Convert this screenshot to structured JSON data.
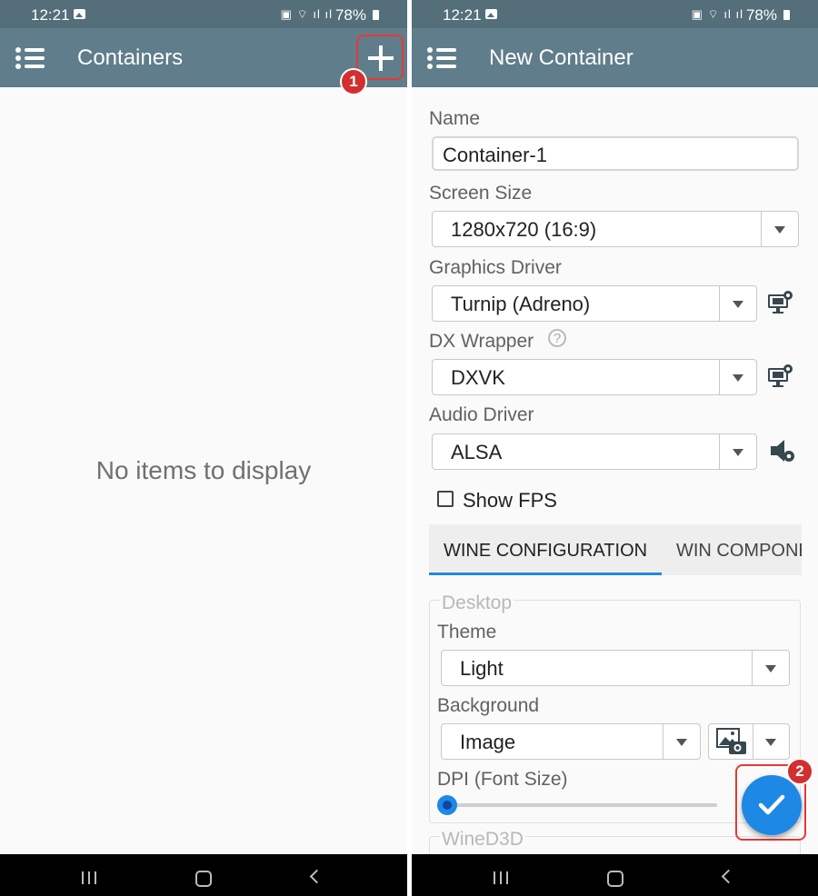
{
  "status_bar": {
    "time": "12:21",
    "battery": "78%"
  },
  "left_screen": {
    "title": "Containers",
    "empty_message": "No items to display",
    "step_badge": "1"
  },
  "right_screen": {
    "title": "New Container",
    "name": {
      "label": "Name",
      "value": "Container-1"
    },
    "screen_size": {
      "label": "Screen Size",
      "value": "1280x720 (16:9)"
    },
    "graphics_driver": {
      "label": "Graphics Driver",
      "value": "Turnip (Adreno)"
    },
    "dx_wrapper": {
      "label": "DX Wrapper",
      "value": "DXVK",
      "help": "?"
    },
    "audio_driver": {
      "label": "Audio Driver",
      "value": "ALSA"
    },
    "show_fps": {
      "label": "Show FPS",
      "checked": false
    },
    "tabs": [
      {
        "label": "WINE CONFIGURATION",
        "active": true
      },
      {
        "label": "WIN COMPONENTS",
        "active": false
      }
    ],
    "desktop": {
      "legend": "Desktop",
      "theme": {
        "label": "Theme",
        "value": "Light"
      },
      "background": {
        "label": "Background",
        "value": "Image"
      },
      "dpi": {
        "label": "DPI (Font Size)",
        "level": 0
      }
    },
    "wined3d_legend": "WineD3D",
    "step_badge": "2"
  },
  "colors": {
    "toolbar": "#607d8b",
    "status_bar": "#546e7a",
    "accent": "#1e88e5",
    "highlight": "#e53935"
  },
  "icons": [
    "menu-icon",
    "plus-icon",
    "monitor-settings-icon",
    "speaker-settings-icon",
    "image-camera-icon",
    "check-icon"
  ]
}
